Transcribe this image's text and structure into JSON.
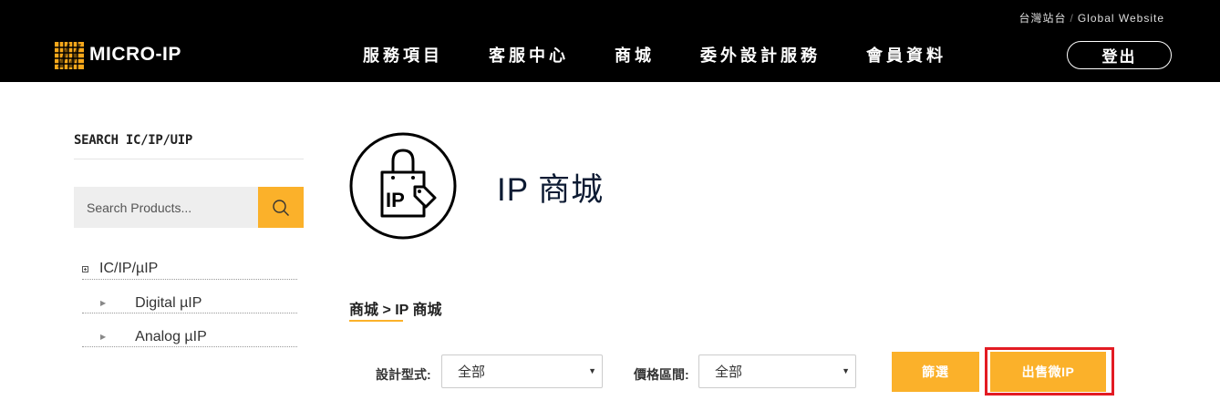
{
  "header": {
    "region_local": "台灣站台",
    "region_sep": "/",
    "region_global": "Global Website",
    "logo_text": "MICRO-IP",
    "nav": [
      {
        "label": "服務項目"
      },
      {
        "label": "客服中心"
      },
      {
        "label": "商城"
      },
      {
        "label": "委外設計服務"
      },
      {
        "label": "會員資料"
      }
    ],
    "logout_label": "登出"
  },
  "sidebar": {
    "title": "SEARCH IC/IP/UIP",
    "search_placeholder": "Search Products...",
    "search_icon": "search-icon",
    "tree": {
      "root_label": "IC/IP/µIP",
      "children": [
        {
          "label": "Digital µIP"
        },
        {
          "label": "Analog µIP"
        }
      ]
    }
  },
  "main": {
    "hero_icon": "shopping-bag-ip-icon",
    "hero_icon_text": "IP",
    "title": "IP 商城",
    "breadcrumb": "商城 > IP 商城",
    "filters": {
      "design_type_label": "設計型式:",
      "design_type_value": "全部",
      "price_range_label": "價格區間:",
      "price_range_value": "全部"
    },
    "filter_button": "篩選",
    "sell_button": "出售微IP"
  },
  "colors": {
    "accent": "#fbb12a",
    "header_bg": "#000000",
    "highlight": "#e31b23",
    "title": "#0d1b33"
  }
}
